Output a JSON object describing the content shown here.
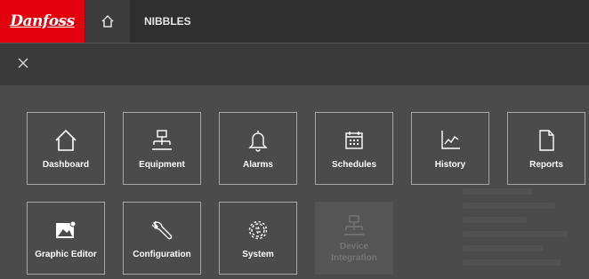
{
  "header": {
    "logo_text": "Danfoss",
    "title": "NIBBLES",
    "brand_color": "#e2000f"
  },
  "menu": {
    "tiles": [
      {
        "label": "Dashboard",
        "icon": "home-icon",
        "enabled": true
      },
      {
        "label": "Equipment",
        "icon": "network-icon",
        "enabled": true
      },
      {
        "label": "Alarms",
        "icon": "bell-icon",
        "enabled": true
      },
      {
        "label": "Schedules",
        "icon": "calendar-icon",
        "enabled": true
      },
      {
        "label": "History",
        "icon": "chart-icon",
        "enabled": true
      },
      {
        "label": "Reports",
        "icon": "document-icon",
        "enabled": true
      },
      {
        "label": "Graphic Editor",
        "icon": "image-icon",
        "enabled": true
      },
      {
        "label": "Configuration",
        "icon": "wrench-icon",
        "enabled": true
      },
      {
        "label": "System",
        "icon": "gears-icon",
        "enabled": true
      },
      {
        "label_line1": "Device",
        "label_line2": "Integration",
        "icon": "network-icon",
        "enabled": false
      }
    ]
  }
}
